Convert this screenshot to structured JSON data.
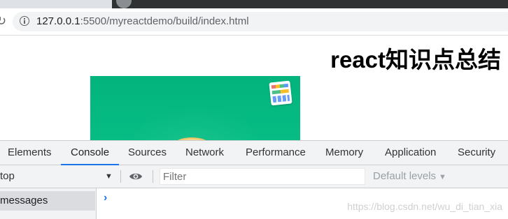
{
  "browser": {
    "url_host": "127.0.0.1",
    "url_rest": ":5500/myreactdemo/build/index.html"
  },
  "page": {
    "title": "react知识点总结"
  },
  "devtools": {
    "tabs": [
      {
        "label": "Elements",
        "active": false
      },
      {
        "label": "Console",
        "active": true
      },
      {
        "label": "Sources",
        "active": false
      },
      {
        "label": "Network",
        "active": false
      },
      {
        "label": "Performance",
        "active": false
      },
      {
        "label": "Memory",
        "active": false
      },
      {
        "label": "Application",
        "active": false
      },
      {
        "label": "Security",
        "active": false
      }
    ],
    "context": "top",
    "filter_placeholder": "Filter",
    "levels": "Default levels",
    "sidebar_item": "messages",
    "prompt": "›",
    "accent_color": "#1a73e8"
  },
  "watermark": "https://blog.csdn.net/wu_di_tian_xia"
}
